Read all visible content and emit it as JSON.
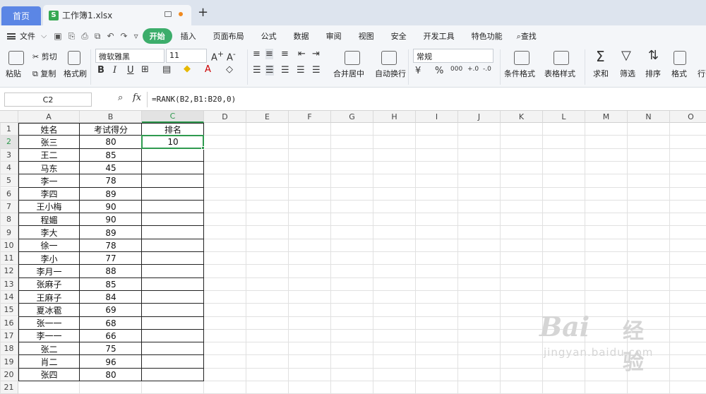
{
  "tabs": {
    "home": "首页",
    "file": "工作簿1.xlsx",
    "add": "+"
  },
  "menu": {
    "file": "文件",
    "items": [
      "开始",
      "插入",
      "页面布局",
      "公式",
      "数据",
      "审阅",
      "视图",
      "安全",
      "开发工具",
      "特色功能"
    ],
    "search": "查找"
  },
  "ribbon": {
    "paste": "粘贴",
    "cut": "剪切",
    "copy": "复制",
    "format_painter": "格式刷",
    "font_name": "微软雅黑",
    "font_size": "11",
    "merge": "合并居中",
    "wrap": "自动换行",
    "number_format": "常规",
    "cond_format": "条件格式",
    "table_style": "表格样式",
    "sum": "求和",
    "filter": "筛选",
    "sort": "排序",
    "format": "格式",
    "rowcol": "行列"
  },
  "formula_bar": {
    "cell_ref": "C2",
    "fx": "fx",
    "formula": "=RANK(B2,B1:B20,0)"
  },
  "columns": [
    "A",
    "B",
    "C",
    "D",
    "E",
    "F",
    "G",
    "H",
    "I",
    "J",
    "K",
    "L",
    "M",
    "N",
    "O"
  ],
  "rows": [
    [
      "姓名",
      "考试得分",
      "排名"
    ],
    [
      "张三",
      "80",
      "10"
    ],
    [
      "王二",
      "85",
      ""
    ],
    [
      "马东",
      "45",
      ""
    ],
    [
      "李一",
      "78",
      ""
    ],
    [
      "李四",
      "89",
      ""
    ],
    [
      "王小梅",
      "90",
      ""
    ],
    [
      "程媚",
      "90",
      ""
    ],
    [
      "李大",
      "89",
      ""
    ],
    [
      "徐一",
      "78",
      ""
    ],
    [
      "李小",
      "77",
      ""
    ],
    [
      "李月一",
      "88",
      ""
    ],
    [
      "张麻子",
      "85",
      ""
    ],
    [
      "王麻子",
      "84",
      ""
    ],
    [
      "夏冰雹",
      "69",
      ""
    ],
    [
      "张一一",
      "68",
      ""
    ],
    [
      "李一一",
      "66",
      ""
    ],
    [
      "张二",
      "75",
      ""
    ],
    [
      "肖二",
      "96",
      ""
    ],
    [
      "张四",
      "80",
      ""
    ]
  ],
  "watermark": {
    "brand": "Bai",
    "brand_cn": "经验",
    "url": "jingyan.baidu.com"
  }
}
